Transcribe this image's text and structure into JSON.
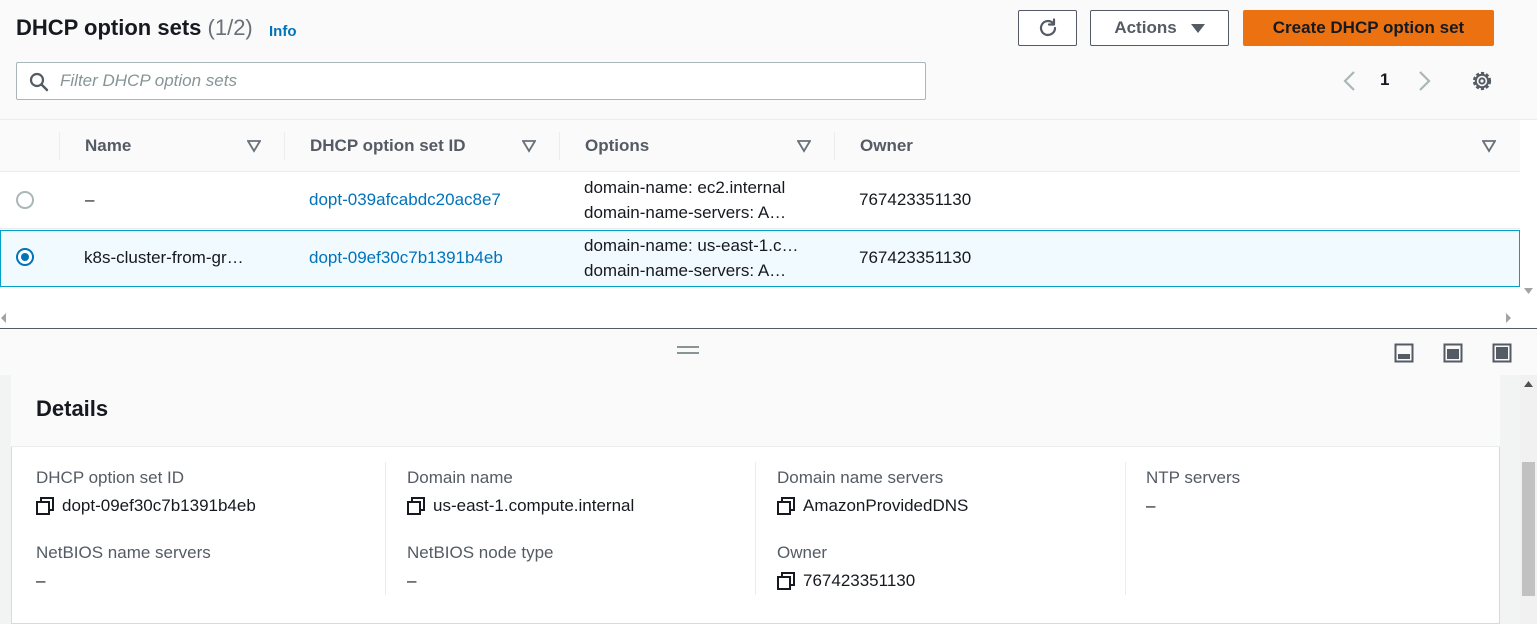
{
  "header": {
    "title": "DHCP option sets",
    "count": "(1/2)",
    "info_link": "Info"
  },
  "toolbar": {
    "refresh_icon": "refresh-icon",
    "actions_label": "Actions",
    "create_label": "Create DHCP option set",
    "accent_color": "#ec7211"
  },
  "filter": {
    "placeholder": "Filter DHCP option sets",
    "value": ""
  },
  "pagination": {
    "current_page": "1"
  },
  "table": {
    "columns": [
      "Name",
      "DHCP option set ID",
      "Options",
      "Owner"
    ],
    "rows": [
      {
        "selected": false,
        "name": "–",
        "id": "dopt-039afcabdc20ac8e7",
        "option_line1": "domain-name: ec2.internal",
        "option_line2": "domain-name-servers: A…",
        "owner": "767423351130"
      },
      {
        "selected": true,
        "name": "k8s-cluster-from-gr…",
        "id": "dopt-09ef30c7b1391b4eb",
        "option_line1": "domain-name: us-east-1.c…",
        "option_line2": "domain-name-servers: A…",
        "owner": "767423351130"
      }
    ]
  },
  "details": {
    "title": "Details",
    "fields": {
      "option_set_id_label": "DHCP option set ID",
      "option_set_id_value": "dopt-09ef30c7b1391b4eb",
      "domain_name_label": "Domain name",
      "domain_name_value": "us-east-1.compute.internal",
      "dns_label": "Domain name servers",
      "dns_value": "AmazonProvidedDNS",
      "ntp_label": "NTP servers",
      "ntp_value": "–",
      "netbios_servers_label": "NetBIOS name servers",
      "netbios_servers_value": "–",
      "netbios_node_label": "NetBIOS node type",
      "netbios_node_value": "–",
      "owner_label": "Owner",
      "owner_value": "767423351130"
    }
  }
}
